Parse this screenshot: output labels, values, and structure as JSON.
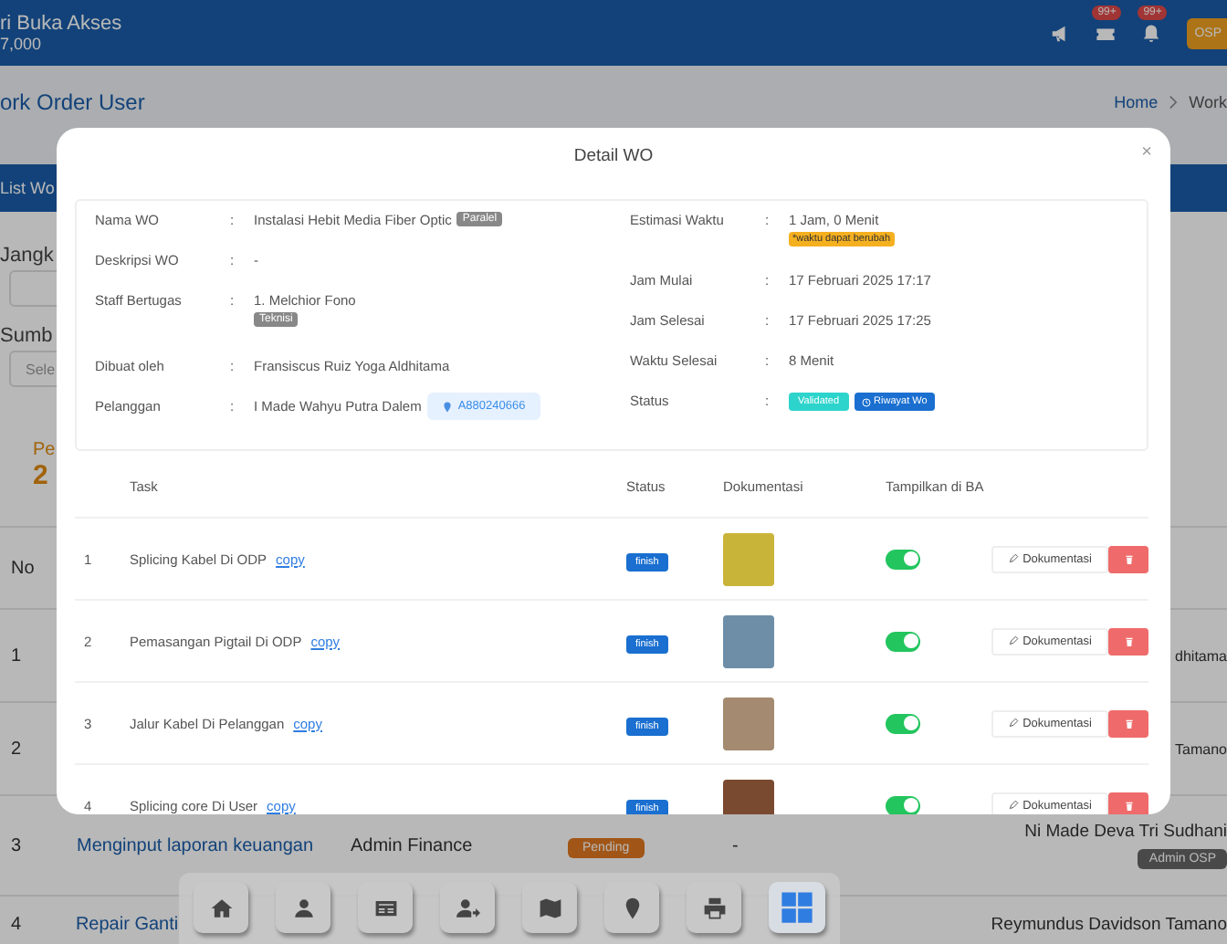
{
  "header": {
    "title": "ri Buka Akses",
    "subtitle": "7,000",
    "badges": [
      {
        "kind": "ticket",
        "count": "99+"
      },
      {
        "kind": "bell",
        "count": "99+"
      }
    ],
    "avatar": "OSP"
  },
  "page_title": "ork Order User",
  "breadcrumb": [
    "Home",
    "Work"
  ],
  "list_panel": {
    "title": "List Wo",
    "filter_1": {
      "label": "Jangk"
    },
    "filter_2": {
      "label": "Sumb",
      "placeholder": "Sele"
    },
    "summary": {
      "label": "Pe",
      "value": "2"
    },
    "table": {
      "columns": [
        "No"
      ],
      "rows": [
        {
          "no": "1",
          "staff": "dhitama"
        },
        {
          "no": "2",
          "staff": "Tamano"
        },
        {
          "no": "3",
          "task": "Menginput laporan keuangan",
          "role": "Admin Finance",
          "status": "Pending",
          "note": "-",
          "staff": "Ni Made Deva Tri Sudhani",
          "staff_tag": "Admin OSP"
        },
        {
          "no": "4",
          "task": "Repair Ganti",
          "staff": "Reymundus Davidson Tamano"
        }
      ]
    }
  },
  "modal": {
    "title": "Detail WO",
    "close": "×",
    "left": [
      {
        "label": "Nama WO",
        "value": "Instalasi Hebit Media Fiber Optic",
        "tag": "Paralel"
      },
      {
        "label": "Deskripsi WO",
        "value": "-"
      },
      {
        "label": "Staff Bertugas",
        "value": "1. Melchior Fono",
        "tag": "Teknisi"
      },
      {
        "label": "Dibuat oleh",
        "value": "Fransiscus Ruiz Yoga Aldhitama"
      },
      {
        "label": "Pelanggan",
        "value": "I Made Wahyu Putra Dalem",
        "chip": "A880240666"
      }
    ],
    "right": [
      {
        "label": "Estimasi Waktu",
        "value": "1 Jam, 0 Menit",
        "note": "*waktu dapat berubah"
      },
      {
        "label": "Jam Mulai",
        "value": "17 Februari 2025 17:17"
      },
      {
        "label": "Jam Selesai",
        "value": "17 Februari 2025 17:25"
      },
      {
        "label": "Waktu Selesai",
        "value": "8 Menit"
      },
      {
        "label": "Status",
        "badges": [
          {
            "kind": "status",
            "text": "Validated"
          },
          {
            "kind": "history",
            "text": "Riwayat Wo"
          }
        ]
      }
    ],
    "colon": ":",
    "columns": [
      "Task",
      "Status",
      "Dokumentasi",
      "Tampilkan di BA"
    ],
    "tasks": [
      {
        "no": "1",
        "task": "Splicing Kabel Di ODP",
        "link": "copy",
        "status": "finish",
        "shown": true,
        "button": "Dokumentasi"
      },
      {
        "no": "2",
        "task": "Pemasangan Pigtail Di ODP",
        "link": "copy",
        "status": "finish",
        "shown": true,
        "button": "Dokumentasi"
      },
      {
        "no": "3",
        "task": "Jalur Kabel Di Pelanggan",
        "link": "copy",
        "status": "finish",
        "shown": true,
        "button": "Dokumentasi"
      },
      {
        "no": "4",
        "task": "Splicing core Di User",
        "link": "copy",
        "status": "finish",
        "shown": true,
        "button": "Dokumentasi"
      }
    ]
  },
  "dock": {
    "items": [
      {
        "kind": "home",
        "selected": false
      },
      {
        "kind": "user",
        "selected": false
      },
      {
        "kind": "card",
        "selected": false
      },
      {
        "kind": "user-share",
        "selected": false
      },
      {
        "kind": "map",
        "selected": false
      },
      {
        "kind": "pin",
        "selected": false
      },
      {
        "kind": "print",
        "selected": false
      },
      {
        "kind": "grid",
        "selected": true
      }
    ]
  }
}
